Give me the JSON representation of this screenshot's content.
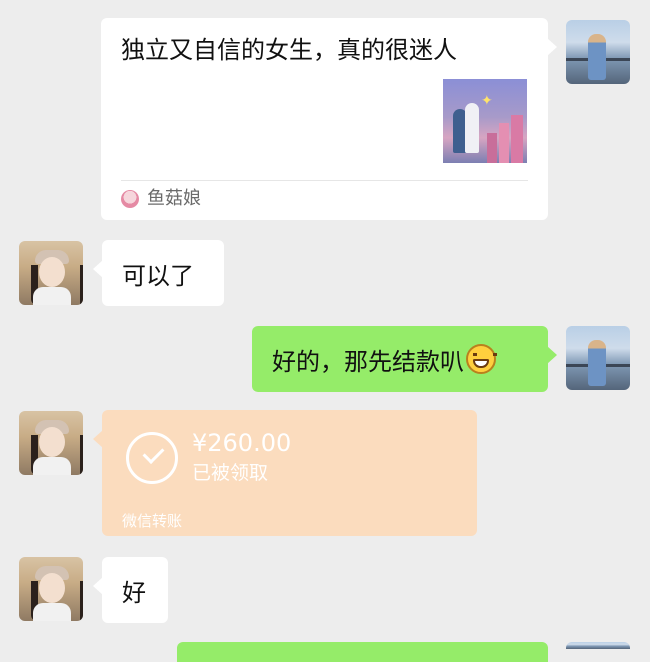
{
  "messages": {
    "link_card": {
      "title": "独立又自信的女生，真的很迷人",
      "source_name": "鱼菇娘"
    },
    "msg1": "可以了",
    "msg2": "好的，那先结款叭",
    "transfer": {
      "amount": "¥260.00",
      "status": "已被领取",
      "label": "微信转账"
    },
    "msg3": "好"
  },
  "colors": {
    "background": "#ededed",
    "sent_bubble": "#95ec69",
    "received_bubble": "#ffffff",
    "transfer_bubble": "#fbdcbe"
  }
}
